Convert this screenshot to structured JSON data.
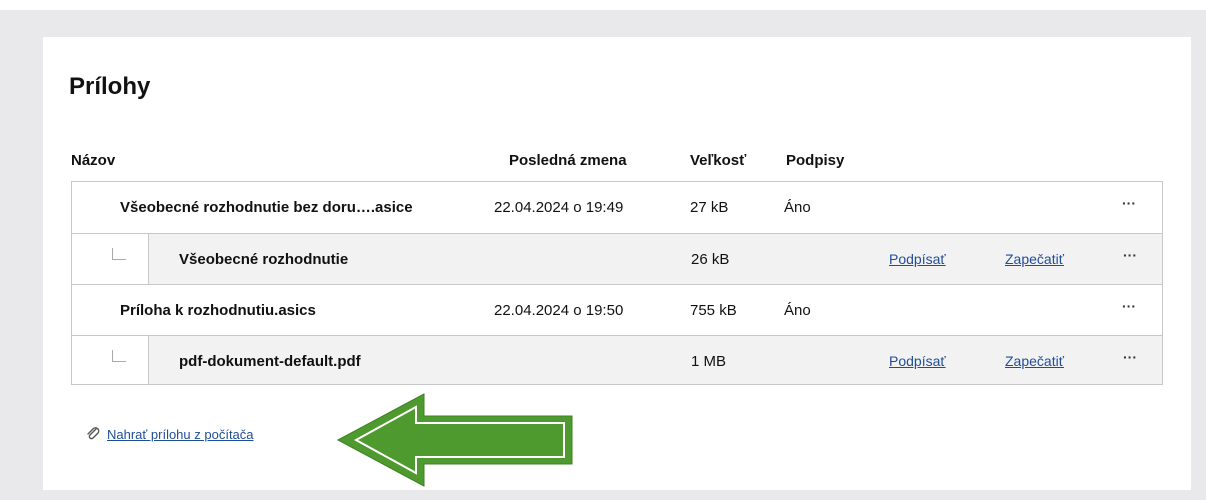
{
  "section": {
    "title": "Prílohy"
  },
  "columns": {
    "name": "Názov",
    "modified": "Posledná zmena",
    "size": "Veľkosť",
    "signatures": "Podpisy"
  },
  "rows": [
    {
      "name": "Všeobecné rozhodnutie bez doru….asice",
      "modified": "22.04.2024 o 19:49",
      "size": "27 kB",
      "signatures": "Áno",
      "menu": "···"
    },
    {
      "name": "Všeobecné rozhodnutie",
      "modified": "",
      "size": "26 kB",
      "sign_link": "Podpísať",
      "seal_link": "Zapečatiť",
      "menu": "···"
    },
    {
      "name": "Príloha k rozhodnutiu.asics",
      "modified": "22.04.2024 o 19:50",
      "size": "755 kB",
      "signatures": "Áno",
      "menu": "···"
    },
    {
      "name": "pdf-dokument-default.pdf",
      "modified": "",
      "size": "1 MB",
      "sign_link": "Podpísať",
      "seal_link": "Zapečatiť",
      "menu": "···"
    }
  ],
  "upload": {
    "label": "Nahrať prílohu z počítača",
    "icon": "paperclip-icon"
  },
  "colors": {
    "link": "#1f4e99",
    "annotation_arrow": "#4e9a2f",
    "child_row_bg": "#f2f2f2",
    "page_bg": "#e9e9ec"
  }
}
